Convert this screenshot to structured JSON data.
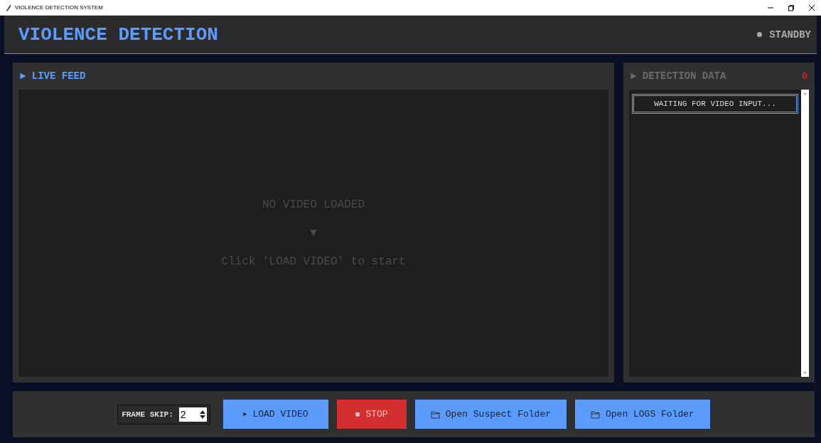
{
  "window": {
    "title": "VIOLENCE DETECTION SYSTEM"
  },
  "header": {
    "title": "VIOLENCE DETECTION",
    "status": "STANDBY"
  },
  "live_feed": {
    "heading": "► LIVE FEED",
    "message": "NO VIDEO LOADED",
    "arrow": "▼",
    "hint": "Click 'LOAD VIDEO' to start"
  },
  "detection_data": {
    "heading": "► DETECTION DATA",
    "count": "0",
    "entries": [
      "WAITING FOR VIDEO INPUT..."
    ]
  },
  "controls": {
    "frame_skip": {
      "label": "FRAME SKIP:",
      "value": "2"
    },
    "buttons": [
      {
        "kind": "play",
        "icon": "►",
        "label": "LOAD VIDEO",
        "disabled": false
      },
      {
        "kind": "stop",
        "icon": "■",
        "label": "STOP",
        "disabled": true
      },
      {
        "kind": "folder",
        "label": "Open Suspect Folder",
        "disabled": false
      },
      {
        "kind": "folder",
        "label": "Open LOGS Folder",
        "disabled": false
      }
    ]
  }
}
